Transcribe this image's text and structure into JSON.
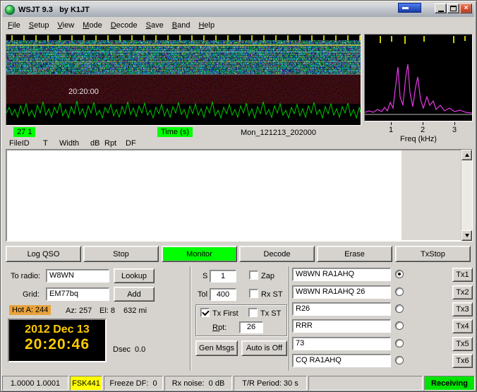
{
  "window": {
    "title": "WSJT 9.3   by K1JT"
  },
  "icons": {
    "app": "globe-icon",
    "close": "×",
    "minimize": "minimize-bar",
    "maximize": "restore-box",
    "scroll_up": "triangle-up",
    "scroll_down": "triangle-down"
  },
  "menu": {
    "items": [
      "File",
      "Setup",
      "View",
      "Mode",
      "Decode",
      "Save",
      "Band",
      "Help"
    ]
  },
  "waterfall": {
    "time_label": "20:20:00",
    "cursor_badge": "27 1",
    "axis_badge": "Time (s)",
    "file_name": "Mon_121213_202000"
  },
  "spectrum": {
    "tick_labels": [
      "1",
      "2",
      "3"
    ],
    "axis_label": "Freq (kHz)"
  },
  "decoder": {
    "columns": [
      "FileID",
      "T",
      "Width",
      "dB",
      "Rpt",
      "DF"
    ],
    "rows": []
  },
  "toolbar": {
    "buttons": [
      "Log QSO",
      "Stop",
      "Monitor",
      "Decode",
      "Erase",
      "TxStop"
    ],
    "active": "Monitor"
  },
  "station": {
    "to_radio_label": "To radio:",
    "to_radio_value": "W8WN",
    "lookup_label": "Lookup",
    "grid_label": "Grid:",
    "grid_value": "EM77bq",
    "add_label": "Add",
    "hot_label": "Hot A: 244",
    "az_label": "Az: 257",
    "el_label": "El: 8",
    "distance_label": "632 mi",
    "clock_date": "2012 Dec 13",
    "clock_time": "20:20:46",
    "dsec_label": "Dsec",
    "dsec_value": "0.0"
  },
  "params": {
    "s_label": "S",
    "s_value": "1",
    "zap_label": "Zap",
    "zap_checked": false,
    "tol_label": "Tol",
    "tol_value": "400",
    "rx_st_label": "Rx ST",
    "rx_st_checked": false,
    "tx_first_label": "Tx First",
    "tx_first_checked": true,
    "tx_st_label": "Tx ST",
    "tx_st_checked": false,
    "rpt_label": "Rpt:",
    "rpt_value": "26",
    "gen_msgs_label": "Gen Msgs",
    "auto_label": "Auto is Off"
  },
  "tx": {
    "selected_index": 0,
    "rows": [
      {
        "message": "W8WN RA1AHQ",
        "button": "Tx1"
      },
      {
        "message": "W8WN RA1AHQ 26",
        "button": "Tx2"
      },
      {
        "message": "R26",
        "button": "Tx3"
      },
      {
        "message": "RRR",
        "button": "Tx4"
      },
      {
        "message": "73",
        "button": "Tx5"
      },
      {
        "message": "CQ RA1AHQ",
        "button": "Tx6"
      }
    ]
  },
  "status": {
    "freq_calib": "1.0000 1.0001",
    "mode": "FSK441",
    "freeze_df": "Freeze DF:  0",
    "rx_noise": "Rx noise:  0 dB",
    "tr_period": "T/R Period: 30 s",
    "state": "Receiving"
  },
  "colors": {
    "monitor_active": "#00ff00",
    "mode_badge": "#ffff00",
    "receiving_badge": "#00e400",
    "hot_badge": "#e8a33d",
    "clock_text": "#ffcc00",
    "badge_green": "#00ff00",
    "spectrum_trace": "#e838e8",
    "waveform": "#00c800"
  }
}
